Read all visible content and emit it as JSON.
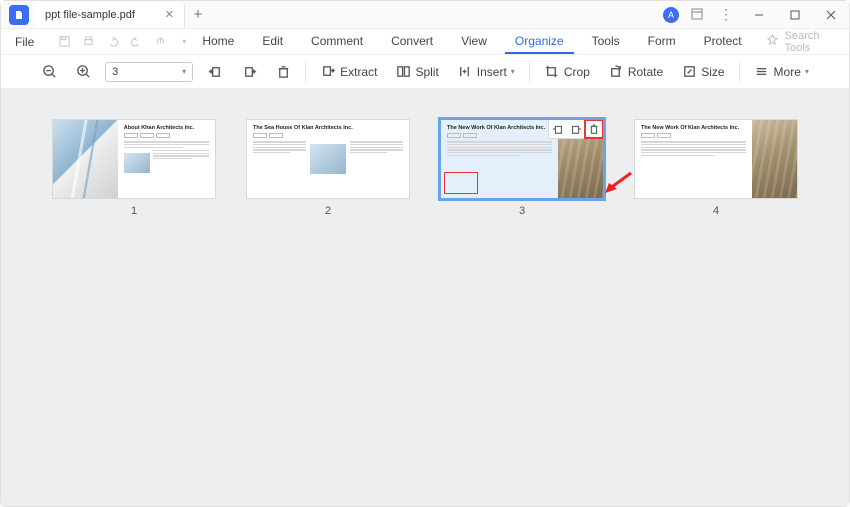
{
  "app": {
    "tab_title": "ppt file-sample.pdf"
  },
  "titlebar": {
    "user_initial": "A"
  },
  "menubar": {
    "file": "File",
    "tabs": [
      "Home",
      "Edit",
      "Comment",
      "Convert",
      "View",
      "Organize",
      "Tools",
      "Form",
      "Protect"
    ],
    "active_tab": "Organize",
    "search_placeholder": "Search Tools"
  },
  "toolbar": {
    "page_value": "3",
    "extract": "Extract",
    "split": "Split",
    "insert": "Insert",
    "crop": "Crop",
    "rotate": "Rotate",
    "size": "Size",
    "more": "More"
  },
  "organize": {
    "pages": [
      {
        "num": "1",
        "title": "About Khan Architects Inc.",
        "layout": "left-img"
      },
      {
        "num": "2",
        "title": "The Sea House Of Klan Architects Inc.",
        "layout": "small-img"
      },
      {
        "num": "3",
        "title": "The New Work Of Klan Architects Inc.",
        "layout": "right-img",
        "selected": true,
        "redbox": true
      },
      {
        "num": "4",
        "title": "The New Work Of Klan Architects Inc.",
        "layout": "right-img"
      }
    ]
  }
}
